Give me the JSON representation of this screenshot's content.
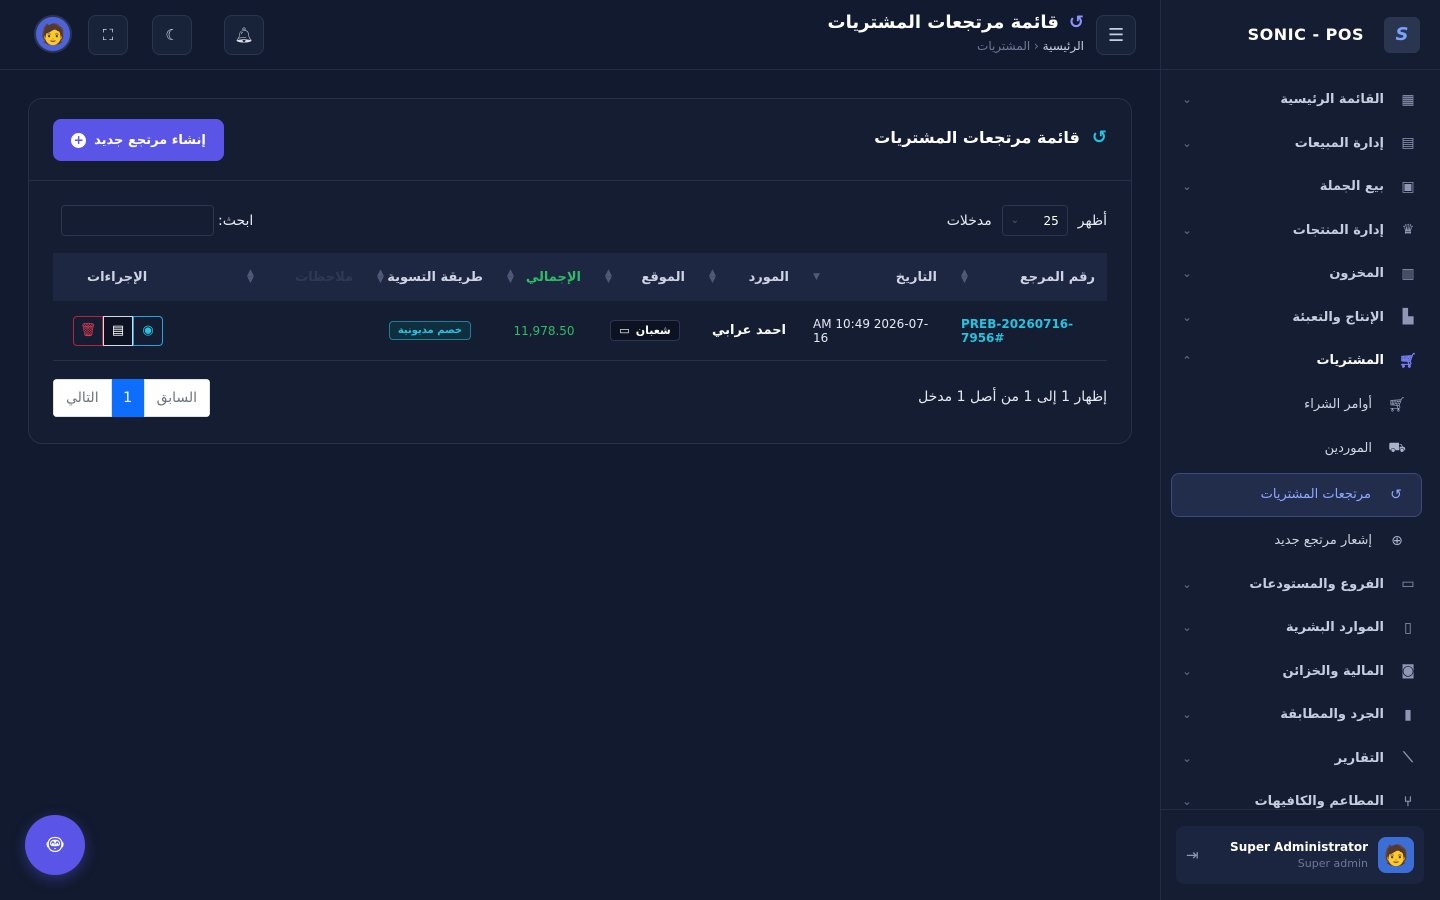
{
  "brand": {
    "name": "SONIC - POS"
  },
  "header": {
    "title": "قائمة مرتجعات المشتريات",
    "breadcrumb_home": "الرئيسية",
    "breadcrumb_sep": "‹",
    "breadcrumb_current": "المشتريات"
  },
  "sidebar": {
    "items": [
      {
        "label": "القائمة الرئيسية",
        "icon": "dashboard-icon"
      },
      {
        "label": "إدارة المبيعات",
        "icon": "cash-register-icon"
      },
      {
        "label": "بيع الجملة",
        "icon": "warehouse-icon"
      },
      {
        "label": "إدارة المنتجات",
        "icon": "shirt-icon"
      },
      {
        "label": "المخزون",
        "icon": "boxes-icon"
      },
      {
        "label": "الإنتاج والتعبئة",
        "icon": "factory-icon"
      },
      {
        "label": "المشتريات",
        "icon": "cart-icon"
      }
    ],
    "purchases_sub": [
      {
        "label": "أوامر الشراء",
        "icon": "cart-icon"
      },
      {
        "label": "الموردين",
        "icon": "truck-icon"
      },
      {
        "label": "مرتجعات المشتريات",
        "icon": "undo-icon"
      },
      {
        "label": "إشعار مرتجع جديد",
        "icon": "plus-circle-icon"
      }
    ],
    "items_after": [
      {
        "label": "الفروع والمستودعات",
        "icon": "store-icon"
      },
      {
        "label": "الموارد البشرية",
        "icon": "id-card-icon"
      },
      {
        "label": "المالية والخزائن",
        "icon": "money-icon"
      },
      {
        "label": "الجرد والمطابقة",
        "icon": "clipboard-icon"
      },
      {
        "label": "التقارير",
        "icon": "chart-icon"
      },
      {
        "label": "المطاعم والكافيهات",
        "icon": "utensils-icon"
      }
    ],
    "user": {
      "name": "Super Administrator",
      "role": "Super admin"
    }
  },
  "card": {
    "title": "قائمة مرتجعات المشتريات",
    "create_label": "إنشاء مرتجع جديد",
    "show_label": "أظهر",
    "entries_value": "25",
    "entries_label": "مدخلات",
    "search_label": "ابحث:",
    "columns": [
      "رقم المرجع",
      "التاريخ",
      "المورد",
      "الموقع",
      "الإجمالي",
      "طريقة التسوية",
      "ملاحظات",
      "الإجراءات"
    ],
    "rows": [
      {
        "ref": "PREB-20260716-7956#",
        "date": "AM 10:49 2026-07-16",
        "supplier": "احمد عرابي",
        "location": "شعبان",
        "total": "11,978.50",
        "method": "خصم مديونية"
      }
    ],
    "info": "إظهار 1 إلى 1 من أصل 1 مدخل",
    "pager": {
      "prev": "السابق",
      "current": "1",
      "next": "التالي"
    }
  },
  "colors": {
    "accent": "#5a55e6",
    "cyan": "#27c2e0",
    "green": "#2ebd67",
    "danger": "#e03b52"
  }
}
